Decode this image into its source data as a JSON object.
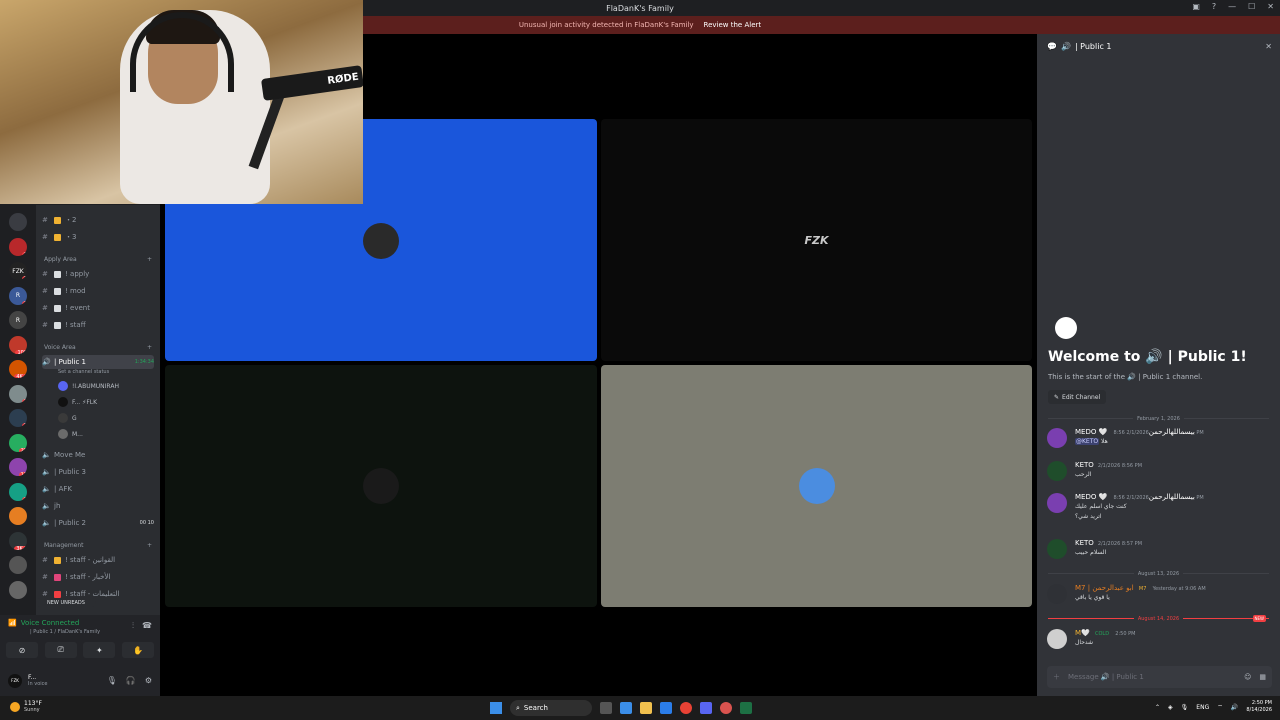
{
  "window": {
    "title": "FlaDanK's Family",
    "controls": [
      "▣",
      "?",
      "—",
      "☐",
      "✕"
    ]
  },
  "alert": {
    "text": "Unusual join activity detected in FlaDanK's Family",
    "action": "Review the Alert"
  },
  "webcam": {
    "mic_brand": "RØDE"
  },
  "rail": {
    "servers": [
      {
        "label": "",
        "badge": ""
      },
      {
        "label": "",
        "badge": "1"
      },
      {
        "label": "FZK",
        "badge": "1"
      },
      {
        "label": "R",
        "badge": "1"
      },
      {
        "label": "R",
        "badge": ""
      },
      {
        "label": "",
        "badge": "109"
      },
      {
        "label": "",
        "badge": "4K+"
      },
      {
        "label": "",
        "badge": "2"
      },
      {
        "label": "",
        "badge": "3"
      },
      {
        "label": "",
        "badge": "28"
      },
      {
        "label": "",
        "badge": "11"
      },
      {
        "label": "",
        "badge": "1"
      },
      {
        "label": "",
        "badge": ""
      },
      {
        "label": "",
        "badge": "3K+"
      },
      {
        "label": "",
        "badge": ""
      },
      {
        "label": "",
        "badge": ""
      }
    ]
  },
  "sidebar": {
    "channels_top": [
      {
        "label": "・2",
        "emoji_color": "#f0b232"
      },
      {
        "label": "・3",
        "emoji_color": "#f0b232"
      }
    ],
    "apply_area": {
      "title": "Apply Area",
      "channels": [
        "! apply",
        "! mod",
        "! event",
        "! staff"
      ]
    },
    "voice_area": {
      "title": "Voice Area",
      "active_channel": "| Public 1",
      "active_time": "1:34:34",
      "status_hint": "Set a channel status",
      "members": [
        "!ا.ABUMUNIRAH",
        "F... ⚡FLK",
        "G",
        "M..."
      ],
      "channels": [
        "Move Me",
        "| Public 3",
        "| AFK",
        "jh",
        "| Public 2"
      ],
      "public2_counts": "00 10"
    },
    "management": {
      "title": "Management",
      "channels": [
        "! staff - القوانين",
        "! staff - الأخبار",
        "! staff - التعليمات"
      ]
    },
    "new_unreads": "NEW UNREADS"
  },
  "voice": {
    "status": "Voice Connected",
    "location": "| Public 1 / FlaDanK's Family",
    "buttons": [
      "⊘",
      "⎚",
      "✦",
      "✋"
    ]
  },
  "user": {
    "avatar_text": "FZK",
    "name": "F...",
    "status": "In voice"
  },
  "stage": {
    "tiles": [
      {
        "name": "tile-blue",
        "bg": "#1a56db",
        "avatar_bg": "#2a2a2a",
        "label": ""
      },
      {
        "name": "tile-fzk",
        "bg": "#0a0a0a",
        "avatar_bg": "transparent",
        "label": "FZK"
      },
      {
        "name": "tile-dark-green",
        "bg": "#0d130e",
        "avatar_bg": "#1a1a1a",
        "label": ""
      },
      {
        "name": "tile-grey",
        "bg": "#7d7d72",
        "avatar_bg": "#4b8de0",
        "label": ""
      }
    ]
  },
  "rpanel": {
    "channel": "| Public 1",
    "welcome": "Welcome to 🔊 | Public 1!",
    "welcome_sub": "This is the start of the 🔊 | Public 1 channel.",
    "edit_channel": "Edit Channel",
    "date1": "February 1, 2026",
    "messages": [
      {
        "author": "MEDO 🤍 بيسماللهالرحمن",
        "author_color": "#ffffff",
        "time": "2/1/2026 8:56 PM",
        "mention": "@KETO",
        "body": "هلا",
        "avatar": "#7a3fb0"
      },
      {
        "author": "KETO",
        "author_color": "#ffffff",
        "time": "2/1/2026 8:56 PM",
        "mention": "",
        "body": "الرحب",
        "avatar": "#1f4d2b"
      },
      {
        "author": "MEDO 🤍 بيسماللهالرحمن",
        "author_color": "#ffffff",
        "time": "2/1/2026 8:56 PM",
        "mention": "",
        "body": "كنت جاي اسلم عليك",
        "avatar": "#7a3fb0"
      },
      {
        "author": "KETO",
        "author_color": "#ffffff",
        "time": "2/1/2026 8:57 PM",
        "mention": "",
        "body": "السلام حبيب",
        "avatar": "#1f4d2b"
      }
    ],
    "extra_line": "اتريد شي؟",
    "date2": "August 13, 2026",
    "msg5": {
      "author": "M7 | ابو عبدالرحمن",
      "badge": "M7",
      "time": "Yesterday at 9:06 AM",
      "body": "يا قوي يا باقي",
      "author_color": "#e67e22"
    },
    "date3": "August 14, 2026",
    "new_tag": "NEW",
    "msg6": {
      "author": "M🤍",
      "badge": "COLD",
      "time": "2:50 PM",
      "body": "شدحال",
      "author_color": "#f0b232"
    },
    "composer_placeholder": "Message 🔊 | Public 1"
  },
  "taskbar": {
    "temp": "113°F",
    "weather": "Sunny",
    "search": "Search",
    "lang": "ENG",
    "time": "2:50 PM",
    "date": "8/14/2026"
  }
}
